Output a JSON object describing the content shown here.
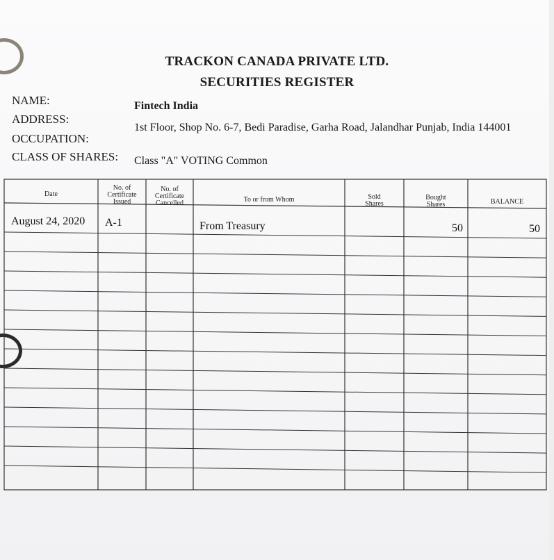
{
  "header": {
    "company": "TRACKON CANADA PRIVATE LTD.",
    "register": "SECURITIES REGISTER"
  },
  "info": {
    "name_label": "NAME:",
    "name_value": "Fintech India",
    "address_label": "ADDRESS:",
    "address_value": "1st Floor, Shop No. 6-7, Bedi Paradise, Garha Road, Jalandhar Punjab, India  144001",
    "occupation_label": "OCCUPATION:",
    "class_label": "CLASS OF SHARES:",
    "class_value": "Class \"A\" VOTING Common"
  },
  "table": {
    "columns": {
      "date": "Date",
      "cert_issued": [
        "No. of",
        "Certificate",
        "Issued"
      ],
      "cert_cancelled": [
        "No. of",
        "Certificate",
        "Cancelled"
      ],
      "party": "To or from Whom",
      "sold": [
        "Sold",
        "Shares"
      ],
      "bought": [
        "Bought",
        "Shares"
      ],
      "balance": "BALANCE"
    },
    "rows": [
      {
        "date": "August 24, 2020",
        "cert_issued": "A-1",
        "cert_cancelled": "",
        "party": "From Treasury",
        "sold": "",
        "bought": "50",
        "balance": "50"
      }
    ]
  },
  "colors": {
    "ring_top": "#8a8479",
    "ring_bottom": "#2b2b2b",
    "line": "#333333"
  }
}
